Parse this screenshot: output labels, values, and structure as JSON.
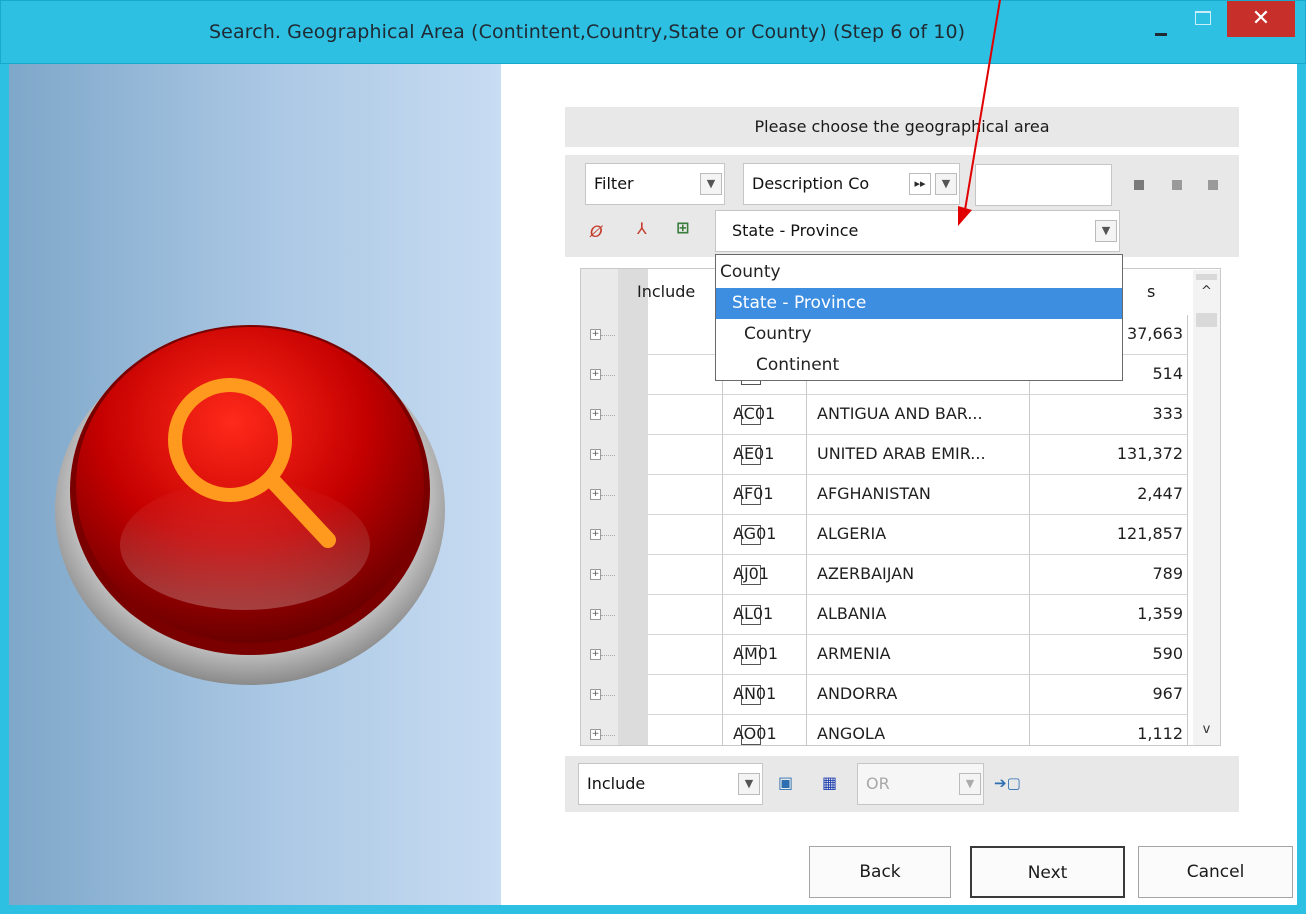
{
  "window": {
    "title": "Search.  Geographical Area (Contintent,Country,State or County) (Step 6 of 10)",
    "close_glyph": "✕"
  },
  "header": {
    "text": "Please choose the geographical area"
  },
  "toolbar": {
    "filter_combo": "Filter",
    "field_combo": "Description Co",
    "level_combo": "State - Province",
    "search_value": ""
  },
  "dropdown": {
    "items": [
      "County",
      "State - Province",
      "Country",
      "Continent"
    ],
    "selected_index": 1
  },
  "grid": {
    "header_include": "Include",
    "header_count": "s",
    "rows": [
      {
        "code": "",
        "desc": "",
        "count": "37,663"
      },
      {
        "code": "",
        "desc": "",
        "count": "514"
      },
      {
        "code": "AC01",
        "desc": "ANTIGUA AND BAR...",
        "count": "333"
      },
      {
        "code": "AE01",
        "desc": "UNITED ARAB EMIR...",
        "count": "131,372"
      },
      {
        "code": "AF01",
        "desc": "AFGHANISTAN",
        "count": "2,447"
      },
      {
        "code": "AG01",
        "desc": "ALGERIA",
        "count": "121,857"
      },
      {
        "code": "AJ01",
        "desc": "AZERBAIJAN",
        "count": "789"
      },
      {
        "code": "AL01",
        "desc": "ALBANIA",
        "count": "1,359"
      },
      {
        "code": "AM01",
        "desc": "ARMENIA",
        "count": "590"
      },
      {
        "code": "AN01",
        "desc": "ANDORRA",
        "count": "967"
      },
      {
        "code": "AO01",
        "desc": "ANGOLA",
        "count": "1,112"
      }
    ]
  },
  "bottom": {
    "include_combo": "Include",
    "operator_combo": "OR"
  },
  "buttons": {
    "back": "Back",
    "next": "Next",
    "cancel": "Cancel"
  },
  "colors": {
    "titlebar": "#2dc0e3",
    "close": "#c7302a",
    "selection": "#3d8ee0",
    "annotation_arrow": "#e00000"
  },
  "icons": [
    "minimize-icon",
    "maximize-icon",
    "close-icon",
    "search-magnifier-icon",
    "clear-filter-icon",
    "remove-filter-icon",
    "tree-select-icon",
    "first-page-icon",
    "prev-page-icon",
    "next-page-icon",
    "properties-icon",
    "grid-icon",
    "add-condition-icon"
  ]
}
